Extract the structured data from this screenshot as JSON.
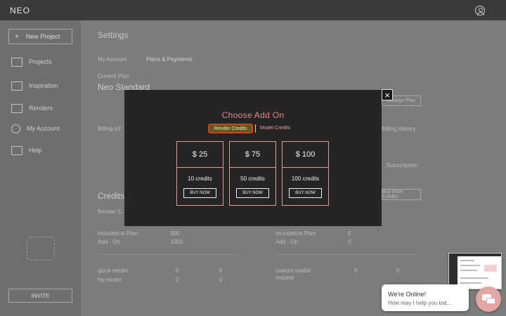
{
  "app": {
    "brand": "NEO"
  },
  "sidebar": {
    "new_project_label": "New Project",
    "items": [
      {
        "label": "Projects",
        "icon": "projects-icon"
      },
      {
        "label": "Inspiration",
        "icon": "book-icon"
      },
      {
        "label": "Renders",
        "icon": "renders-icon"
      },
      {
        "label": "My Account",
        "icon": "user-icon"
      },
      {
        "label": "Help",
        "icon": "mail-icon"
      }
    ],
    "invite_label": "INVITE"
  },
  "settings": {
    "title": "Settings",
    "tabs": [
      "My Account",
      "Plans & Payments"
    ],
    "current_plan_label": "Current Plan",
    "plan_name": "Neo Standard",
    "change_plan_label": "Change Plan",
    "billing_label": "Billing Inf",
    "billing_history_label": "Billing History",
    "subscription_label": "Subscription",
    "credits_label": "Credits",
    "buy_more_label": "Buy More Credits",
    "render_credits_label": "Render C",
    "included_label": "Included in Plan",
    "addon_label": "Add - On",
    "render_included": "300",
    "render_addon": "1000",
    "model_included": "5",
    "model_addon": "0",
    "rows_left": [
      {
        "name": "quick render",
        "a": "0",
        "b": "0"
      },
      {
        "name": "hq render",
        "a": "0",
        "b": "0"
      }
    ],
    "rows_right": [
      {
        "name": "custom model request",
        "a": "0",
        "b": "0"
      }
    ]
  },
  "modal": {
    "title": "Choose Add On",
    "tabs": [
      {
        "label": "Render Credits",
        "active": true
      },
      {
        "label": "Model Credits",
        "active": false
      }
    ],
    "options": [
      {
        "price": "$ 25",
        "credits": "10 credits",
        "button": "BUY NOW"
      },
      {
        "price": "$ 75",
        "credits": "50 credits",
        "button": "BUY NOW"
      },
      {
        "price": "$ 100",
        "credits": "100 credits",
        "button": "BUY NOW"
      }
    ],
    "close_icon": "close-icon"
  },
  "chat": {
    "line1": "We're Online!",
    "line2": "How may I help you tod...",
    "icon": "chat-icon"
  },
  "colors": {
    "accent": "#e08b84",
    "modal_bg": "#262424",
    "active_tab_fill": "#5a5a20",
    "active_tab_border": "#c14a1c",
    "chat_button": "#e3a6a5"
  }
}
